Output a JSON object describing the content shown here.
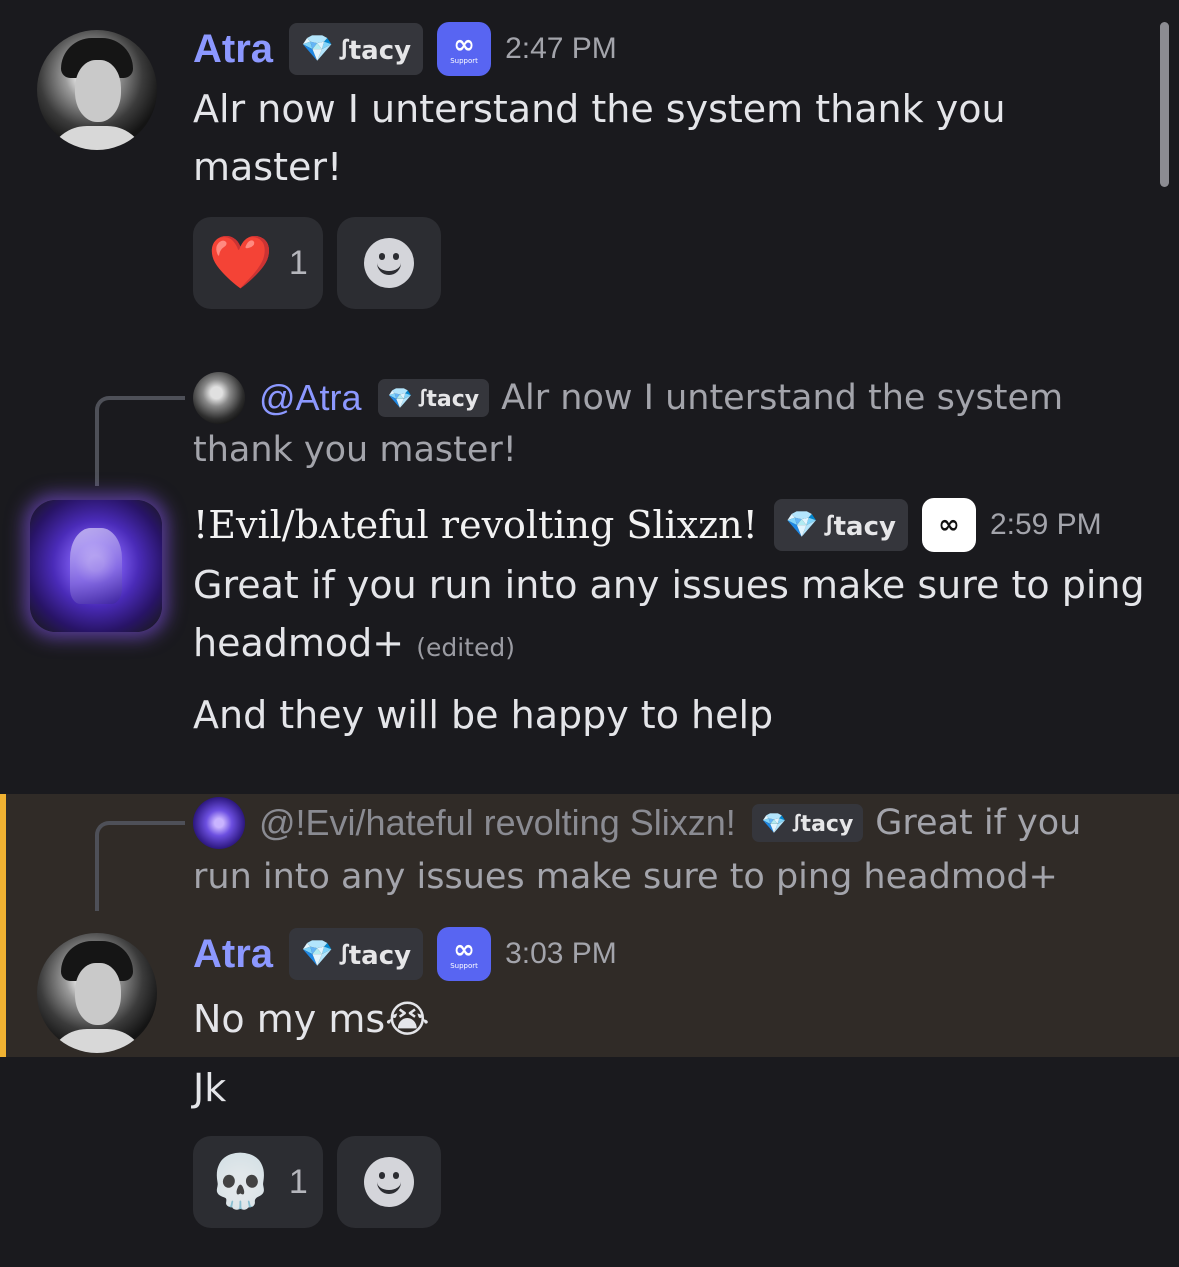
{
  "colors": {
    "background": "#1a1a1e",
    "username": "#8c98ff",
    "highlight": "#302b27",
    "highlight_bar": "#f0b232",
    "support_badge": "#5865f2"
  },
  "tag": {
    "icon": "gem-icon",
    "label": "ꭍtacy"
  },
  "support_badge": {
    "icon": "infinity-icon",
    "glyph": "∞",
    "label": "Support"
  },
  "messages": [
    {
      "author": "Atra",
      "time": "2:47 PM",
      "lines": [
        "Alr now I unterstand the system thank you",
        "master!"
      ],
      "reactions": [
        {
          "emoji": "❤️",
          "icon": "heart-icon",
          "count": "1"
        }
      ]
    },
    {
      "reply": {
        "mention": "@Atra",
        "text_1": "Alr now I unterstand the system",
        "text_2": "thank you master!"
      },
      "author": "!Evil/bʌteful revolting Slixzn!",
      "time": "2:59 PM",
      "lines": [
        "Great if you run into any issues make sure to ping",
        "headmod+"
      ],
      "edited": "(edited)",
      "line_extra": "And they will be happy to help"
    },
    {
      "reply": {
        "mention": "@!Evi/hateful revolting Slixzn!",
        "text_1": "Great if you",
        "text_2": "run into any issues make sure to ping headmod+"
      },
      "author": "Atra",
      "time": "3:03 PM",
      "lines": [
        "No my ms😭"
      ],
      "line_extra": "Jk",
      "reactions": [
        {
          "emoji": "💀",
          "icon": "skull-icon",
          "count": "1"
        }
      ]
    }
  ]
}
